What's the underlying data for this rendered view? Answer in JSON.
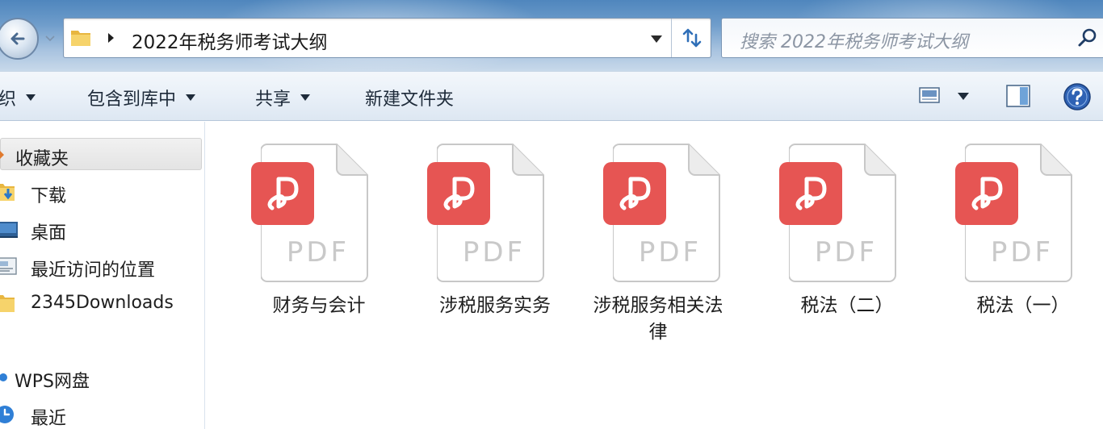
{
  "address_bar": {
    "path": "2022年税务师考试大纲"
  },
  "search": {
    "placeholder": "搜索 2022年税务师考试大纲"
  },
  "command_bar": {
    "organize": "织",
    "include_in_library": "包含到库中",
    "share": "共享",
    "new_folder": "新建文件夹"
  },
  "sidebar": {
    "items": [
      {
        "label": "收藏夹",
        "icon": "star-icon",
        "selected": true
      },
      {
        "label": "下载",
        "icon": "downloads-folder-icon"
      },
      {
        "label": "桌面",
        "icon": "desktop-icon"
      },
      {
        "label": "最近访问的位置",
        "icon": "recent-places-icon"
      },
      {
        "label": "2345Downloads",
        "icon": "folder-icon"
      },
      {
        "label": "WPS网盘",
        "icon": "cloud-dot-icon"
      },
      {
        "label": "最近",
        "icon": "clock-icon"
      }
    ]
  },
  "files": [
    {
      "name": "财务与会计",
      "type_label": "PDF",
      "icon": "wps-pdf-icon"
    },
    {
      "name": "涉税服务实务",
      "type_label": "PDF",
      "icon": "wps-pdf-icon"
    },
    {
      "name": "涉税服务相关法律",
      "type_label": "PDF",
      "icon": "wps-pdf-icon"
    },
    {
      "name": "税法（二）",
      "type_label": "PDF",
      "icon": "wps-pdf-icon"
    },
    {
      "name": "税法（一）",
      "type_label": "PDF",
      "icon": "wps-pdf-icon"
    }
  ],
  "colors": {
    "pdf_badge": "#e65553",
    "title_gradient_top": "#4f86bd",
    "command_bar": "#e9f0f8",
    "help_icon": "#2f62b4"
  }
}
